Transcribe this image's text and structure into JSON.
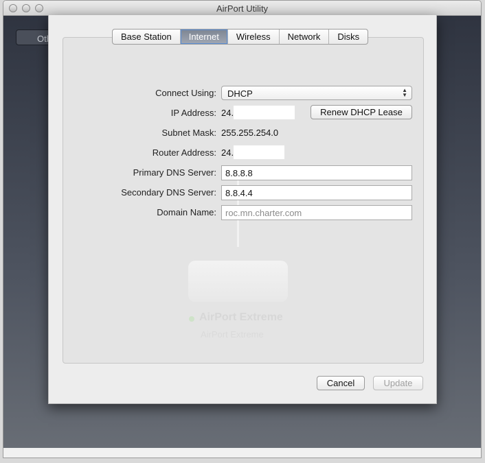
{
  "window": {
    "title": "AirPort Utility"
  },
  "background": {
    "other_button_label": "Oth"
  },
  "tabs": [
    {
      "label": "Base Station",
      "active": false
    },
    {
      "label": "Internet",
      "active": true
    },
    {
      "label": "Wireless",
      "active": false
    },
    {
      "label": "Network",
      "active": false
    },
    {
      "label": "Disks",
      "active": false
    }
  ],
  "form": {
    "connect_using": {
      "label": "Connect Using:",
      "value": "DHCP"
    },
    "ip_address": {
      "label": "IP Address:",
      "value": "24."
    },
    "subnet_mask": {
      "label": "Subnet Mask:",
      "value": "255.255.254.0"
    },
    "router_address": {
      "label": "Router Address:",
      "value": "24."
    },
    "primary_dns": {
      "label": "Primary DNS Server:",
      "value": "8.8.8.8"
    },
    "secondary_dns": {
      "label": "Secondary DNS Server:",
      "value": "8.8.4.4"
    },
    "domain_name": {
      "label": "Domain Name:",
      "placeholder": "roc.mn.charter.com"
    },
    "renew_button": "Renew DHCP Lease"
  },
  "device": {
    "name": "AirPort Extreme",
    "subtitle": "AirPort Extreme"
  },
  "buttons": {
    "cancel": "Cancel",
    "update": "Update"
  }
}
